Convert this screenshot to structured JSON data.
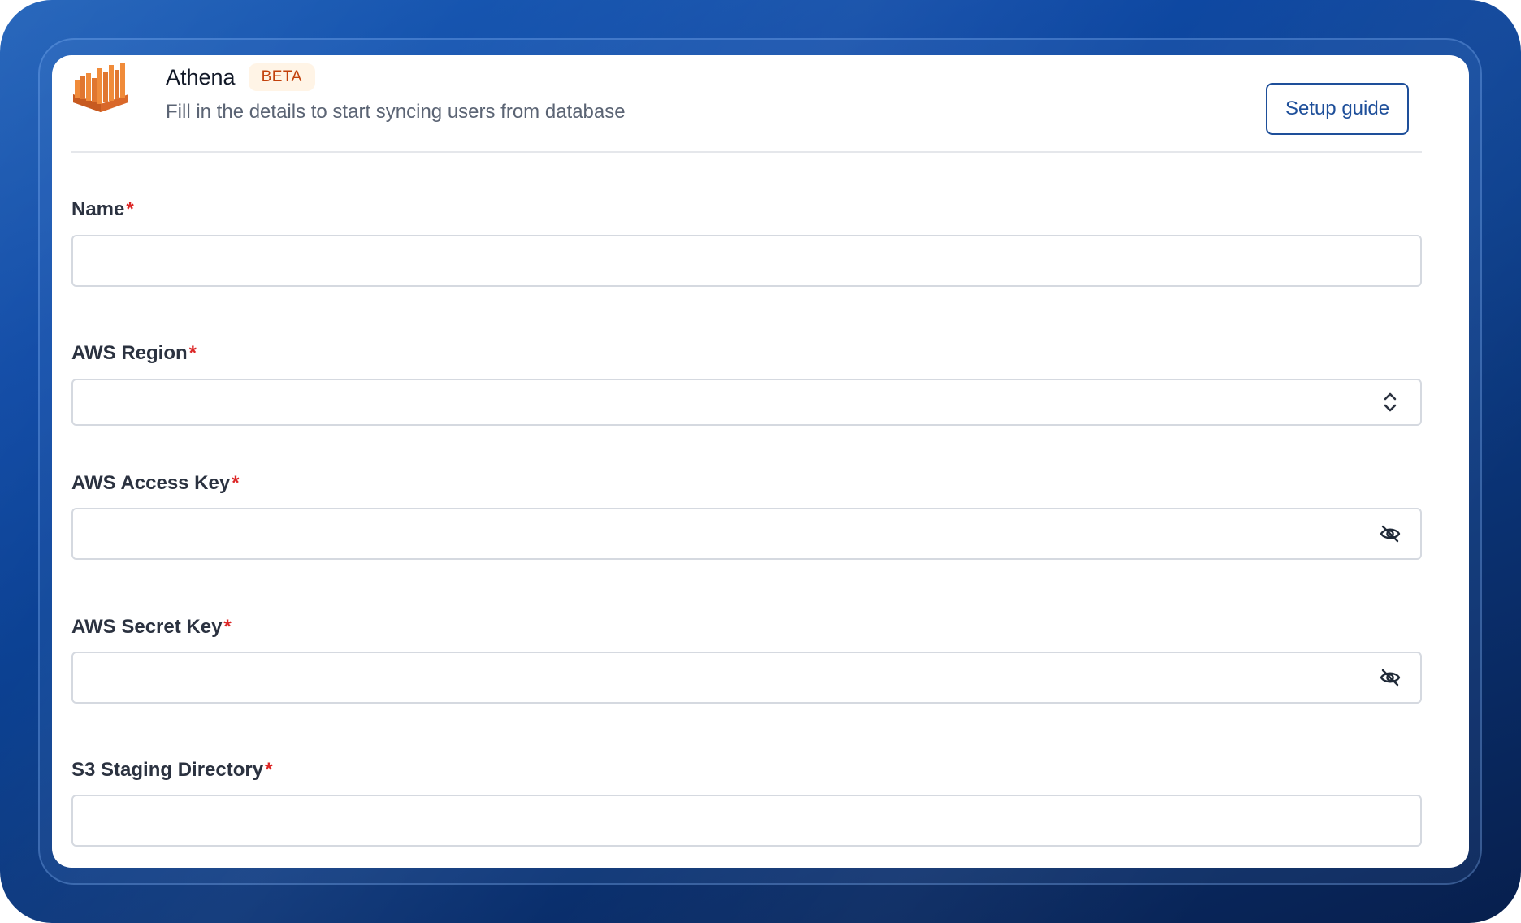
{
  "header": {
    "title": "Athena",
    "badge": "BETA",
    "subtitle": "Fill in the details to start syncing users from database",
    "setup_guide_label": "Setup guide",
    "logo_icon": "aws-athena-logo-icon"
  },
  "colors": {
    "accent": "#1e4f9a",
    "badge_text": "#c2410c",
    "badge_bg": "#fff4e6",
    "required": "#dc2626",
    "logo_orange": "#e8752a"
  },
  "form": {
    "required_marker": "*",
    "name": {
      "label": "Name",
      "value": ""
    },
    "aws_region": {
      "label": "AWS Region",
      "value": "",
      "icon": "chevron-up-down-icon"
    },
    "aws_access_key": {
      "label": "AWS Access Key",
      "value": "",
      "icon": "eye-off-icon"
    },
    "aws_secret_key": {
      "label": "AWS Secret Key",
      "value": "",
      "icon": "eye-off-icon"
    },
    "s3_staging_directory": {
      "label": "S3 Staging Directory",
      "value": ""
    }
  }
}
